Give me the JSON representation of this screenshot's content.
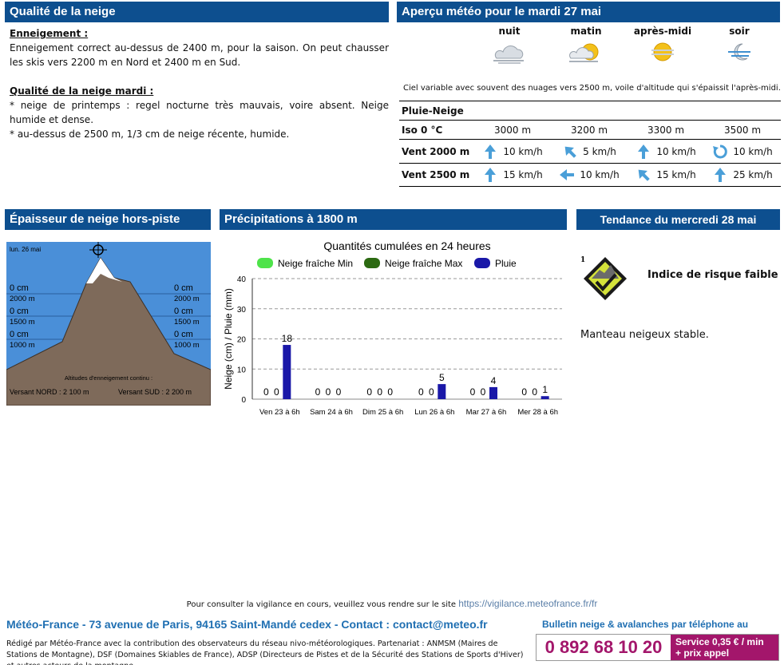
{
  "snow_quality": {
    "header": "Qualité de la neige",
    "enneigement_label": "Enneigement :",
    "enneigement_text": "Enneigement correct au-dessus de 2400 m, pour la saison. On peut chausser les skis vers 2200 m en Nord et 2400 m en Sud.",
    "qualite_label": "Qualité de la neige mardi :",
    "qualite_line1": "* neige de printemps : regel nocturne très mauvais, voire absent. Neige humide et dense.",
    "qualite_line2": "* au-dessus de 2500 m, 1/3 cm de neige récente, humide."
  },
  "weather": {
    "header": "Aperçu météo pour le mardi 27 mai",
    "periods": [
      {
        "name": "nuit",
        "icon": "cloud-moon-icon"
      },
      {
        "name": "matin",
        "icon": "sun-cloud-icon"
      },
      {
        "name": "après-midi",
        "icon": "sun-haze-icon"
      },
      {
        "name": "soir",
        "icon": "moon-haze-icon"
      }
    ],
    "description": "Ciel variable avec souvent des nuages vers 2500 m, voile d'altitude qui s'épaissit l'après-midi.",
    "rows": {
      "pluie_neige": "Pluie-Neige",
      "iso_label": "Iso 0 °C",
      "iso_values": [
        "3000 m",
        "3200 m",
        "3300 m",
        "3500 m"
      ],
      "vent2000_label": "Vent 2000 m",
      "vent2000": [
        {
          "dir": 180,
          "speed": "10 km/h",
          "icon": "arrow-south-icon"
        },
        {
          "dir": 135,
          "speed": "5 km/h",
          "icon": "arrow-southeast-icon"
        },
        {
          "dir": 180,
          "speed": "10 km/h",
          "icon": "arrow-south-icon"
        },
        {
          "dir": -1,
          "speed": "10 km/h",
          "icon": "variable-wind-icon"
        }
      ],
      "vent2500_label": "Vent 2500 m",
      "vent2500": [
        {
          "dir": 180,
          "speed": "15 km/h",
          "icon": "arrow-south-icon"
        },
        {
          "dir": 90,
          "speed": "10 km/h",
          "icon": "arrow-east-icon"
        },
        {
          "dir": 135,
          "speed": "15 km/h",
          "icon": "arrow-southeast-icon"
        },
        {
          "dir": 180,
          "speed": "25 km/h",
          "icon": "arrow-south-icon"
        }
      ]
    }
  },
  "depth": {
    "header": "Épaisseur de neige hors-piste",
    "date": "lun. 26 mai",
    "levels": [
      {
        "alt": "2000  m",
        "north": "0 cm",
        "south": "0 cm"
      },
      {
        "alt": "1500  m",
        "north": "0 cm",
        "south": "0 cm"
      },
      {
        "alt": "1000  m",
        "north": "0 cm",
        "south": "0 cm"
      }
    ],
    "continuous_label": "Altitudes d'enneigement continu :",
    "north": "Versant NORD :   2 100 m",
    "south": "Versant SUD :   2 200 m"
  },
  "precip": {
    "header": "Précipitations à 1800 m"
  },
  "chart_data": {
    "type": "bar",
    "title": "Quantités cumulées en 24 heures",
    "ylabel": "Neige (cm) / Pluie (mm)",
    "xlabel": "",
    "ylim": [
      0,
      40
    ],
    "yticks": [
      0,
      10,
      20,
      30,
      40
    ],
    "categories": [
      "Ven 23 à 6h",
      "Sam 24 à 6h",
      "Dim 25 à 6h",
      "Lun 26 à 6h",
      "Mar 27 à 6h",
      "Mer 28 à 6h"
    ],
    "series": [
      {
        "name": "Neige fraîche Min",
        "color": "#4ee34a",
        "values": [
          0,
          0,
          0,
          0,
          0,
          0
        ]
      },
      {
        "name": "Neige fraîche Max",
        "color": "#2c6a12",
        "values": [
          0,
          0,
          0,
          0,
          0,
          0
        ]
      },
      {
        "name": "Pluie",
        "color": "#1a18a8",
        "values": [
          18,
          0,
          0,
          5,
          4,
          1
        ]
      }
    ],
    "legend": "top",
    "grid": true
  },
  "tendance": {
    "header": "Tendance du mercredi 28 mai",
    "risk_level": "1",
    "risk_text": "Indice de risque faible",
    "note": "Manteau neigeux stable."
  },
  "footer": {
    "vigilance_text": "Pour consulter la vigilance en cours, veuillez vous rendre sur le site",
    "vigilance_link": "https://vigilance.meteofrance.fr/fr",
    "address": "Météo-France - 73 avenue de Paris, 94165 Saint-Mandé cedex - Contact : contact@meteo.fr",
    "credit": "Rédigé par Météo-France avec la contribution des observateurs du réseau nivo-météorologiques. Partenariat : ANMSM (Maires de Stations de Montagne), DSF (Domaines Skiables de France), ADSP (Directeurs de Pistes et de la Sécurité des Stations de Sports d'Hiver) et autres acteurs de la montagne.",
    "phone_label": "Bulletin neige & avalanches par téléphone au",
    "phone": "0 892 68 10 20",
    "price_line1": "Service 0,35 € / min",
    "price_line2": "+ prix appel"
  }
}
